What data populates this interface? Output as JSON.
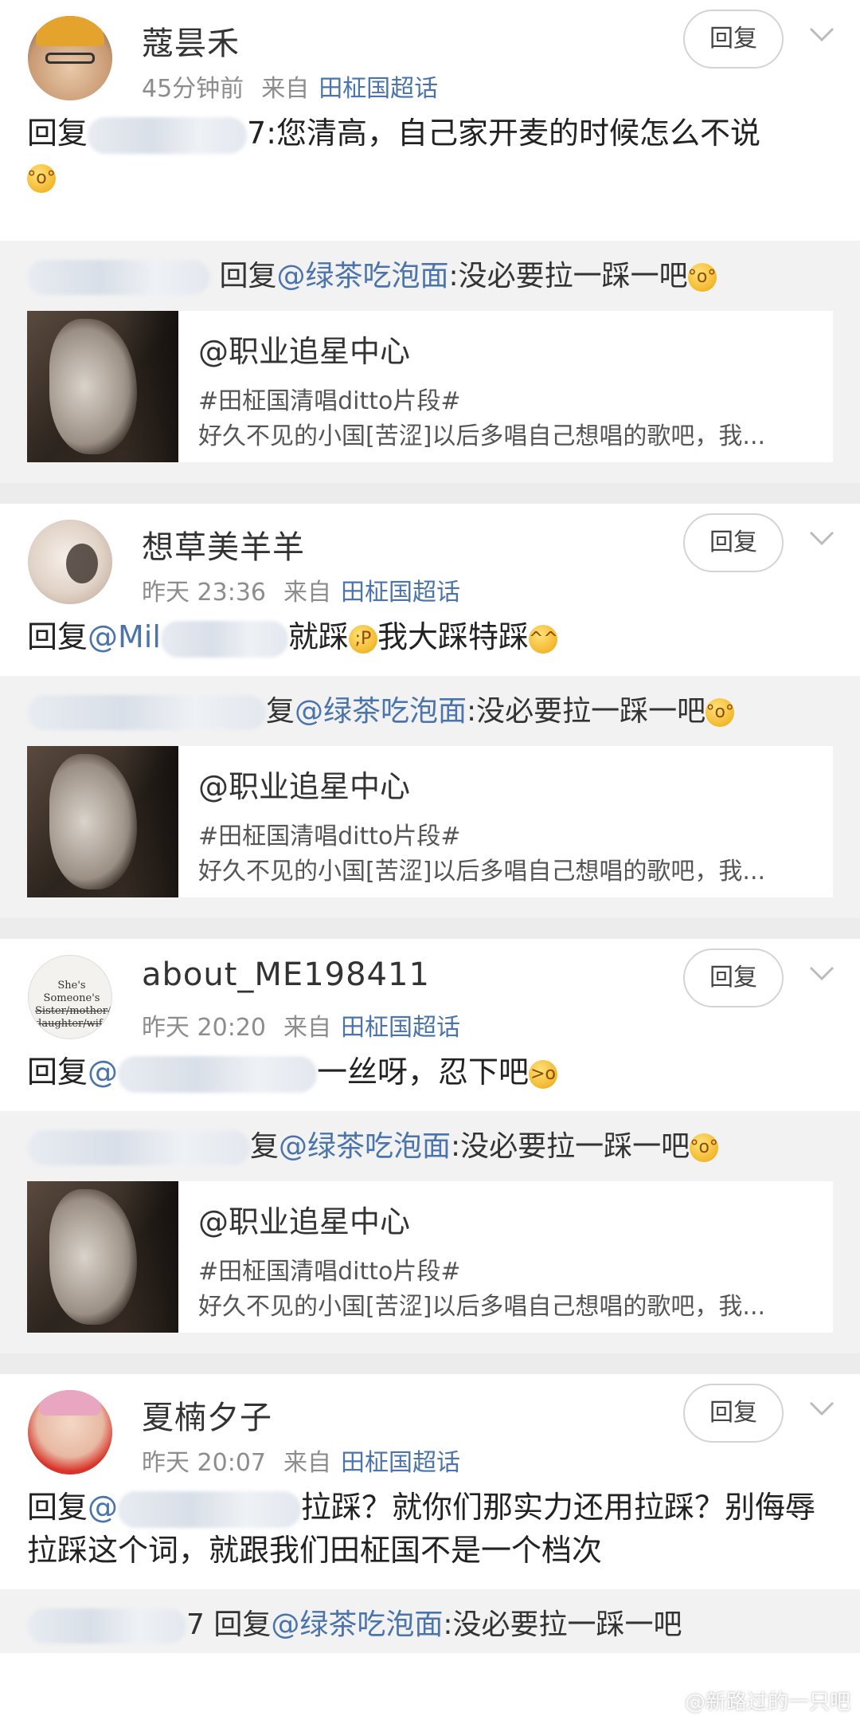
{
  "reply_label": "回复",
  "comments": [
    {
      "name": "蔻昙禾",
      "time": "45分钟前",
      "source_label": "来自",
      "topic": "田柾国超话",
      "body_prefix": "回复",
      "body_tail": "7:您清高，自己家开麦的时候怎么不说",
      "quote_text": " 回复",
      "quote_at": "@绿茶吃泡面",
      "quote_tail": ":没必要拉一踩一吧",
      "share_title": "@职业追星中心",
      "share_tag": "#田柾国清唱ditto片段#",
      "share_desc": "好久不见的小国[苦涩]以后多唱自己想唱的歌吧，我..."
    },
    {
      "name": "想草美羊羊",
      "time": "昨天 23:36",
      "source_label": "来自",
      "topic": "田柾国超话",
      "body_prefix": "回复",
      "body_at": "@Mil",
      "body_tail": "就踩",
      "body_tail2": "我大踩特踩",
      "quote_text": "复",
      "quote_at": "@绿茶吃泡面",
      "quote_tail": ":没必要拉一踩一吧",
      "share_title": "@职业追星中心",
      "share_tag": "#田柾国清唱ditto片段#",
      "share_desc": "好久不见的小国[苦涩]以后多唱自己想唱的歌吧，我..."
    },
    {
      "name": "about_ME198411",
      "time": "昨天 20:20",
      "source_label": "来自",
      "topic": "田柾国超话",
      "body_prefix": "回复",
      "body_at": "@",
      "body_tail": "一丝呀，忍下吧",
      "quote_text": "复",
      "quote_at": "@绿茶吃泡面",
      "quote_tail": ":没必要拉一踩一吧",
      "share_title": "@职业追星中心",
      "share_tag": "#田柾国清唱ditto片段#",
      "share_desc": "好久不见的小国[苦涩]以后多唱自己想唱的歌吧，我...",
      "avatar_text": "She's Someone's Sister/mother/ daughter/wife"
    },
    {
      "name": "夏楠夕子",
      "time": "昨天 20:07",
      "source_label": "来自",
      "topic": "田柾国超话",
      "body_prefix": "回复",
      "body_at": "@",
      "body_tail": "拉踩？就你们那实力还用拉踩？别侮辱拉踩这个词，就跟我们田柾国不是一个档次",
      "quote_text": "7 回复",
      "quote_at": "@绿茶吃泡面",
      "quote_tail": ":没必要拉一踩一吧"
    }
  ],
  "watermark": "@新路过的一只吧",
  "colors": {
    "link": "#4a74ab",
    "meta": "#8d8d8d",
    "separator": "#ececec",
    "quote_bg": "#f2f2f2"
  }
}
